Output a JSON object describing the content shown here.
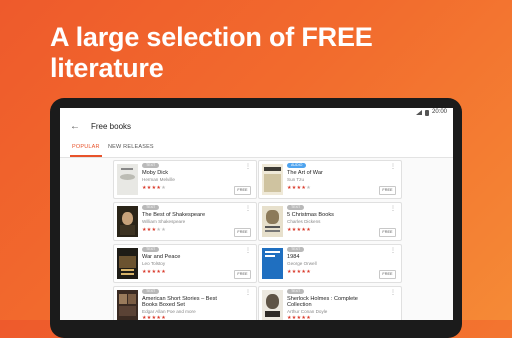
{
  "headline": "A large selection of FREE literature",
  "status": {
    "time": "20:00"
  },
  "appbar": {
    "title": "Free books"
  },
  "tabs": [
    {
      "label": "POPULAR",
      "active": true
    },
    {
      "label": "NEW RELEASES",
      "active": false
    }
  ],
  "books": [
    {
      "title": "Moby Dick",
      "author": "Herman Melville",
      "badge": "TEXT",
      "rating": 4,
      "button": "FREE"
    },
    {
      "title": "The Art of War",
      "author": "Sun Tzu",
      "badge": "AUDIO",
      "rating": 4,
      "button": "FREE"
    },
    {
      "title": "The Best of Shakespeare",
      "author": "William Shakespeare",
      "badge": "TEXT",
      "rating": 3,
      "button": "FREE"
    },
    {
      "title": "5 Christmas Books",
      "author": "Charles Dickens",
      "badge": "TEXT",
      "rating": 5,
      "button": "FREE"
    },
    {
      "title": "War and Peace",
      "author": "Leo Tolstoy",
      "badge": "TEXT",
      "rating": 5,
      "button": "FREE"
    },
    {
      "title": "1984",
      "author": "George Orwell",
      "badge": "TEXT",
      "rating": 5,
      "button": "FREE"
    },
    {
      "title": "American Short Stories – Best Books Boxed Set",
      "author": "Edgar Allan Poe and more",
      "badge": "TEXT",
      "rating": 5,
      "button": "FREE"
    },
    {
      "title": "Sherlock Holmes : Complete Collection",
      "author": "Arthur Conan Doyle",
      "badge": "TEXT",
      "rating": 5,
      "button": "FREE"
    }
  ],
  "colors": {
    "accent": "#e8532b",
    "star": "#d93a2b",
    "audio_badge": "#4ea3ee"
  }
}
